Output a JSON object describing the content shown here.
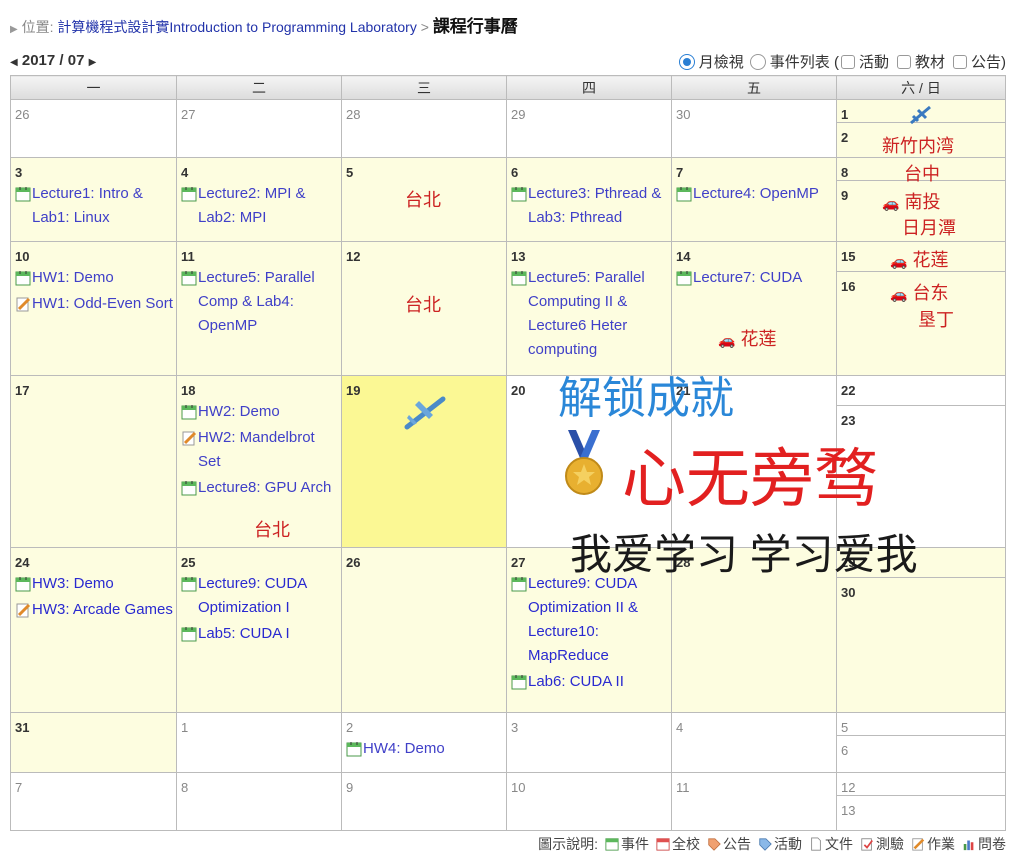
{
  "breadcrumb": {
    "location_label": "位置:",
    "course_link": "計算機程式設計實Introduction to Programming Laboratory",
    "separator": ">",
    "current": "課程行事曆"
  },
  "month_nav": {
    "label": "2017 / 07"
  },
  "view_options": {
    "month_view": "月檢視",
    "event_list": "事件列表 (",
    "activity": "活動",
    "material": "教材",
    "announcement": "公告)"
  },
  "weekdays": [
    "一",
    "二",
    "三",
    "四",
    "五",
    "六 / 日"
  ],
  "days": {
    "r1": [
      "26",
      "27",
      "28",
      "29",
      "30",
      "1",
      "2"
    ],
    "r2": [
      "3",
      "4",
      "5",
      "6",
      "7",
      "8",
      "9"
    ],
    "r3": [
      "10",
      "11",
      "12",
      "13",
      "14",
      "15",
      "16"
    ],
    "r4": [
      "17",
      "18",
      "19",
      "20",
      "21",
      "22",
      "23"
    ],
    "r5": [
      "24",
      "25",
      "26",
      "27",
      "28",
      "29",
      "30"
    ],
    "r6": [
      "31",
      "1",
      "2",
      "3",
      "4",
      "5",
      "6"
    ],
    "r7": [
      "7",
      "8",
      "9",
      "10",
      "11",
      "12",
      "13"
    ]
  },
  "events": {
    "d3": "Lecture1: Intro & Lab1: Linux",
    "d4": "Lecture2: MPI & Lab2: MPI",
    "d6": "Lecture3: Pthread & Lab3: Pthread",
    "d7": "Lecture4: OpenMP",
    "d10a": "HW1: Demo",
    "d10b": "HW1: Odd-Even Sort",
    "d11": "Lecture5: Parallel Comp & Lab4: OpenMP",
    "d13": "Lecture5: Parallel Computing II & Lecture6 Heter computing",
    "d14": "Lecture7: CUDA",
    "d18a": "HW2: Demo",
    "d18b": "HW2: Mandelbrot Set",
    "d18c": "Lecture8: GPU Arch",
    "d24a": "HW3: Demo",
    "d24b": "HW3: Arcade Games",
    "d25a": "Lecture9: CUDA Optimization I",
    "d25b": "Lab5: CUDA I",
    "d27a": "Lecture9: CUDA Optimization II & Lecture10: MapReduce",
    "d27b": "Lab6: CUDA II",
    "aug2": "HW4: Demo"
  },
  "handwritten_notes": {
    "n1": "新竹内湾",
    "n2": "台中",
    "n3": "南投",
    "n4": "日月潭",
    "n5": "台北",
    "n6": "台北",
    "n7": "花莲",
    "n8": "台东",
    "n9": "垦丁",
    "n10": "花莲",
    "n11": "台北"
  },
  "overlay": {
    "line1": "解锁成就",
    "line2": "心无旁骛",
    "line3": "我爱学习 学习爱我"
  },
  "legend": {
    "title": "圖示說明:",
    "items": [
      "事件",
      "全校",
      "公告",
      "活動",
      "文件",
      "測驗",
      "作業",
      "問卷"
    ]
  },
  "colors": {
    "event_link": "#4040c8",
    "note_red": "#d42020",
    "highlight_day": "#fbf894",
    "cell_yellow": "#fdfde0",
    "overlay_blue": "#2a87d8",
    "overlay_red": "#e22020"
  }
}
